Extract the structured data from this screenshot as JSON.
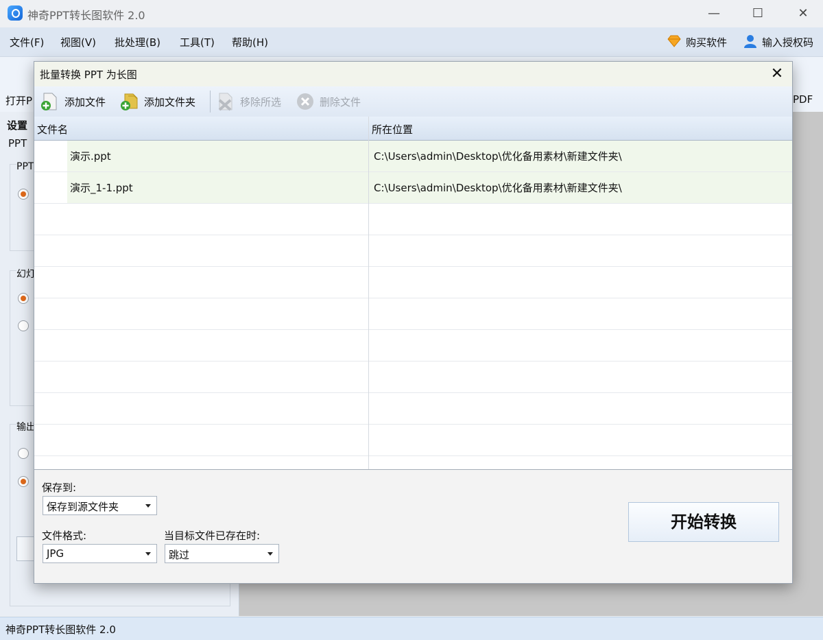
{
  "app": {
    "title": "神奇PPT转长图软件 2.0",
    "window_controls": {
      "minimize": "—",
      "maximize": "☐",
      "close": "✕"
    }
  },
  "menu": {
    "items": [
      "文件(F)",
      "视图(V)",
      "批处理(B)",
      "工具(T)",
      "帮助(H)"
    ],
    "buy": "购买软件",
    "license": "输入授权码"
  },
  "ribbon": {
    "open_label": "打开P",
    "pdf_label": "PDF"
  },
  "left_panel": {
    "settings_tab": "设置",
    "ppt_label": "PPT",
    "group1_title": "PPT",
    "group2_title": "幻灯",
    "group3_title": "输出"
  },
  "status": {
    "text": "神奇PPT转长图软件 2.0"
  },
  "dialog": {
    "title": "批量转换 PPT 为长图",
    "close": "✕",
    "toolbar": {
      "add_file": "添加文件",
      "add_folder": "添加文件夹",
      "remove_selected": "移除所选",
      "delete_file": "删除文件"
    },
    "columns": {
      "name": "文件名",
      "location": "所在位置"
    },
    "rows": [
      {
        "name": "演示.ppt",
        "location": "C:\\Users\\admin\\Desktop\\优化备用素材\\新建文件夹\\"
      },
      {
        "name": "演示_1-1.ppt",
        "location": "C:\\Users\\admin\\Desktop\\优化备用素材\\新建文件夹\\"
      }
    ],
    "save_to_label": "保存到:",
    "save_to_value": "保存到源文件夹",
    "format_label": "文件格式:",
    "format_value": "JPG",
    "exists_label": "当目标文件已存在时:",
    "exists_value": "跳过",
    "start_button": "开始转换"
  },
  "colors": {
    "accent_radio": "#e06a1b",
    "row_fill": "#f0f7eb",
    "menubar": "#dde6f2"
  }
}
